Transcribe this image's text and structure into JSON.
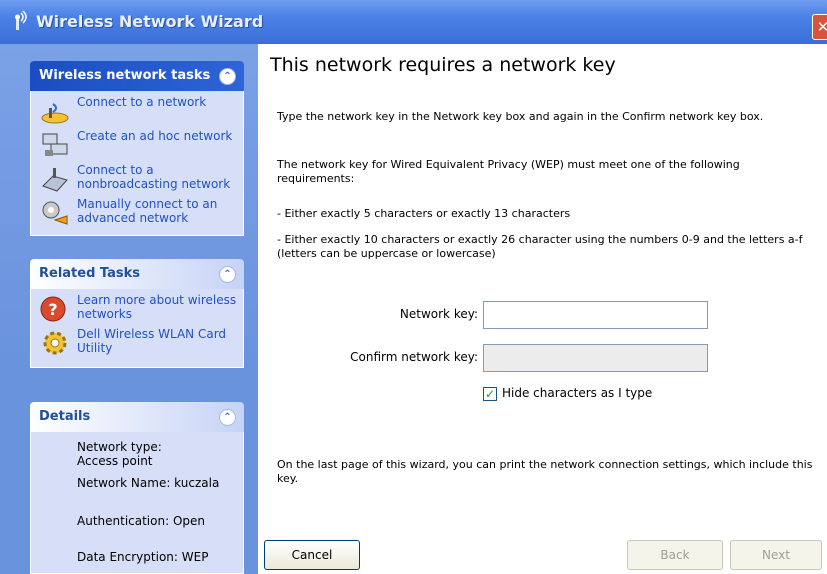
{
  "window": {
    "title": "Wireless Network Wizard",
    "close_glyph": "✕",
    "icon": "wireless-antenna-icon"
  },
  "sidebar": {
    "collapse_glyph": "⌃",
    "network_tasks": {
      "title": "Wireless network tasks",
      "items": [
        {
          "label": "Connect to a network",
          "icon": "network-connect-icon"
        },
        {
          "label": "Create an ad hoc network",
          "icon": "ad-hoc-network-icon"
        },
        {
          "label": "Connect to a nonbroadcasting network",
          "icon": "nonbroadcast-network-icon"
        },
        {
          "label": "Manually connect to an advanced network",
          "icon": "advanced-network-icon"
        }
      ]
    },
    "related_tasks": {
      "title": "Related Tasks",
      "items": [
        {
          "label": "Learn more about wireless networks",
          "icon": "help-icon"
        },
        {
          "label": "Dell Wireless WLAN Card Utility",
          "icon": "gear-icon"
        }
      ]
    },
    "details": {
      "title": "Details",
      "lines": [
        "Network type: Access point",
        "Network Name: kuczala",
        "Authentication: Open",
        "Data Encryption: WEP"
      ]
    }
  },
  "main": {
    "heading": "This network requires a network key",
    "intro": "Type the network key in the Network key box and again in the Confirm network key box.",
    "wep_requirement": "The network key for Wired Equivalent Privacy (WEP) must meet one of the following requirements:",
    "rule_1": "- Either exactly 5 characters or exactly 13 characters",
    "rule_2": "- Either exactly 10 characters or exactly 26 character using the numbers 0-9 and the letters a-f (letters can be uppercase or lowercase)",
    "network_key_label": "Network key:",
    "network_key_value": "",
    "confirm_key_label": "Confirm network key:",
    "confirm_key_value": "",
    "hide_chars_label": "Hide characters as I type",
    "hide_chars_checked": true,
    "footer_note": "On the last page of this wizard, you can print the network connection settings, which include this key."
  },
  "buttons": {
    "cancel": "Cancel",
    "back": "Back",
    "next": "Next"
  }
}
